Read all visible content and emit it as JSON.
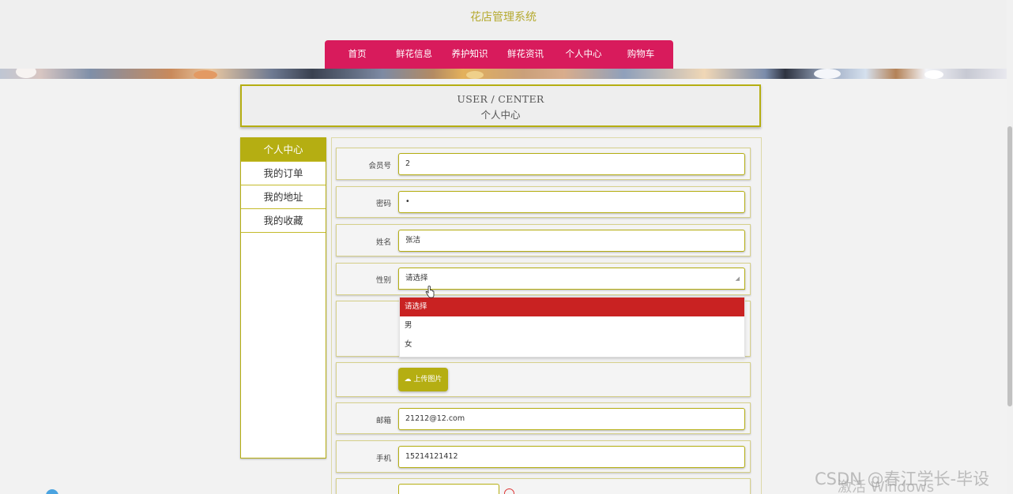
{
  "site": {
    "title": "花店管理系统"
  },
  "nav": {
    "items": [
      "首页",
      "鲜花信息",
      "养护知识",
      "鲜花资讯",
      "个人中心",
      "购物车"
    ]
  },
  "user_center": {
    "title_en": "USER / CENTER",
    "title_cn": "个人中心"
  },
  "sidebar": {
    "items": [
      "个人中心",
      "我的订单",
      "我的地址",
      "我的收藏"
    ],
    "active": "个人中心"
  },
  "form": {
    "member_no": {
      "label": "会员号",
      "value": "2"
    },
    "password": {
      "label": "密码",
      "value": "•"
    },
    "name": {
      "label": "姓名",
      "value": "张洁"
    },
    "gender": {
      "label": "性别",
      "selected": "请选择",
      "options": [
        "请选择",
        "男",
        "女"
      ]
    },
    "upload": {
      "label": "上传图片",
      "icon": "cloud-upload-icon"
    },
    "email": {
      "label": "邮箱",
      "value": "21212@12.com"
    },
    "phone": {
      "label": "手机",
      "value": "15214121412"
    }
  },
  "watermarks": {
    "csdn": "CSDN @春江学长-毕设",
    "windows": "激活 Windows"
  },
  "colors": {
    "accent": "#b5ae12",
    "nav_bg": "#d81b5c",
    "dropdown_selected": "#c92222"
  }
}
